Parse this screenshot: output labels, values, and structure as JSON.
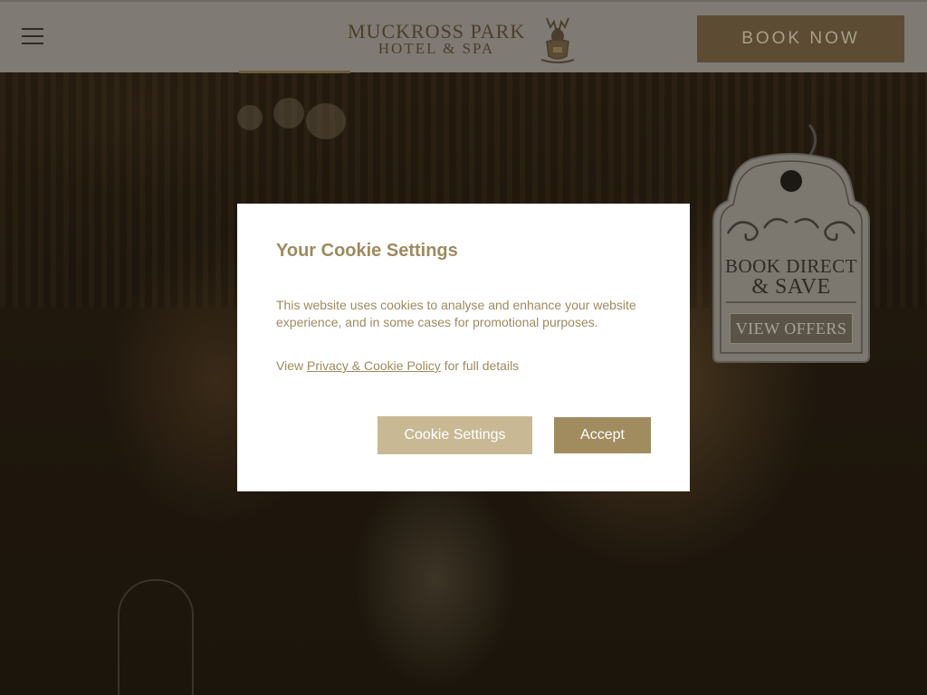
{
  "header": {
    "logo_line1": "MUCKROSS PARK",
    "logo_line2": "HOTEL & SPA",
    "book_now_label": "BOOK NOW"
  },
  "promo_tag": {
    "line1": "BOOK DIRECT",
    "line2": "& SAVE",
    "offers_label": "VIEW OFFERS"
  },
  "cookie_modal": {
    "title": "Your Cookie Settings",
    "text": "This website uses cookies to analyse and enhance your website experience, and in some cases for promotional purposes.",
    "policy_prefix": "View ",
    "policy_link": "Privacy & Cookie Policy",
    "policy_suffix": " for full details",
    "settings_label": "Cookie Settings",
    "accept_label": "Accept"
  },
  "colors": {
    "accent": "#a08c5f",
    "accent_light": "#c8b994",
    "header_bg": "#7f7a74",
    "book_now_bg": "#5b4c33"
  },
  "icons": {
    "menu": "hamburger-menu-icon",
    "crest": "stag-crest-icon"
  }
}
